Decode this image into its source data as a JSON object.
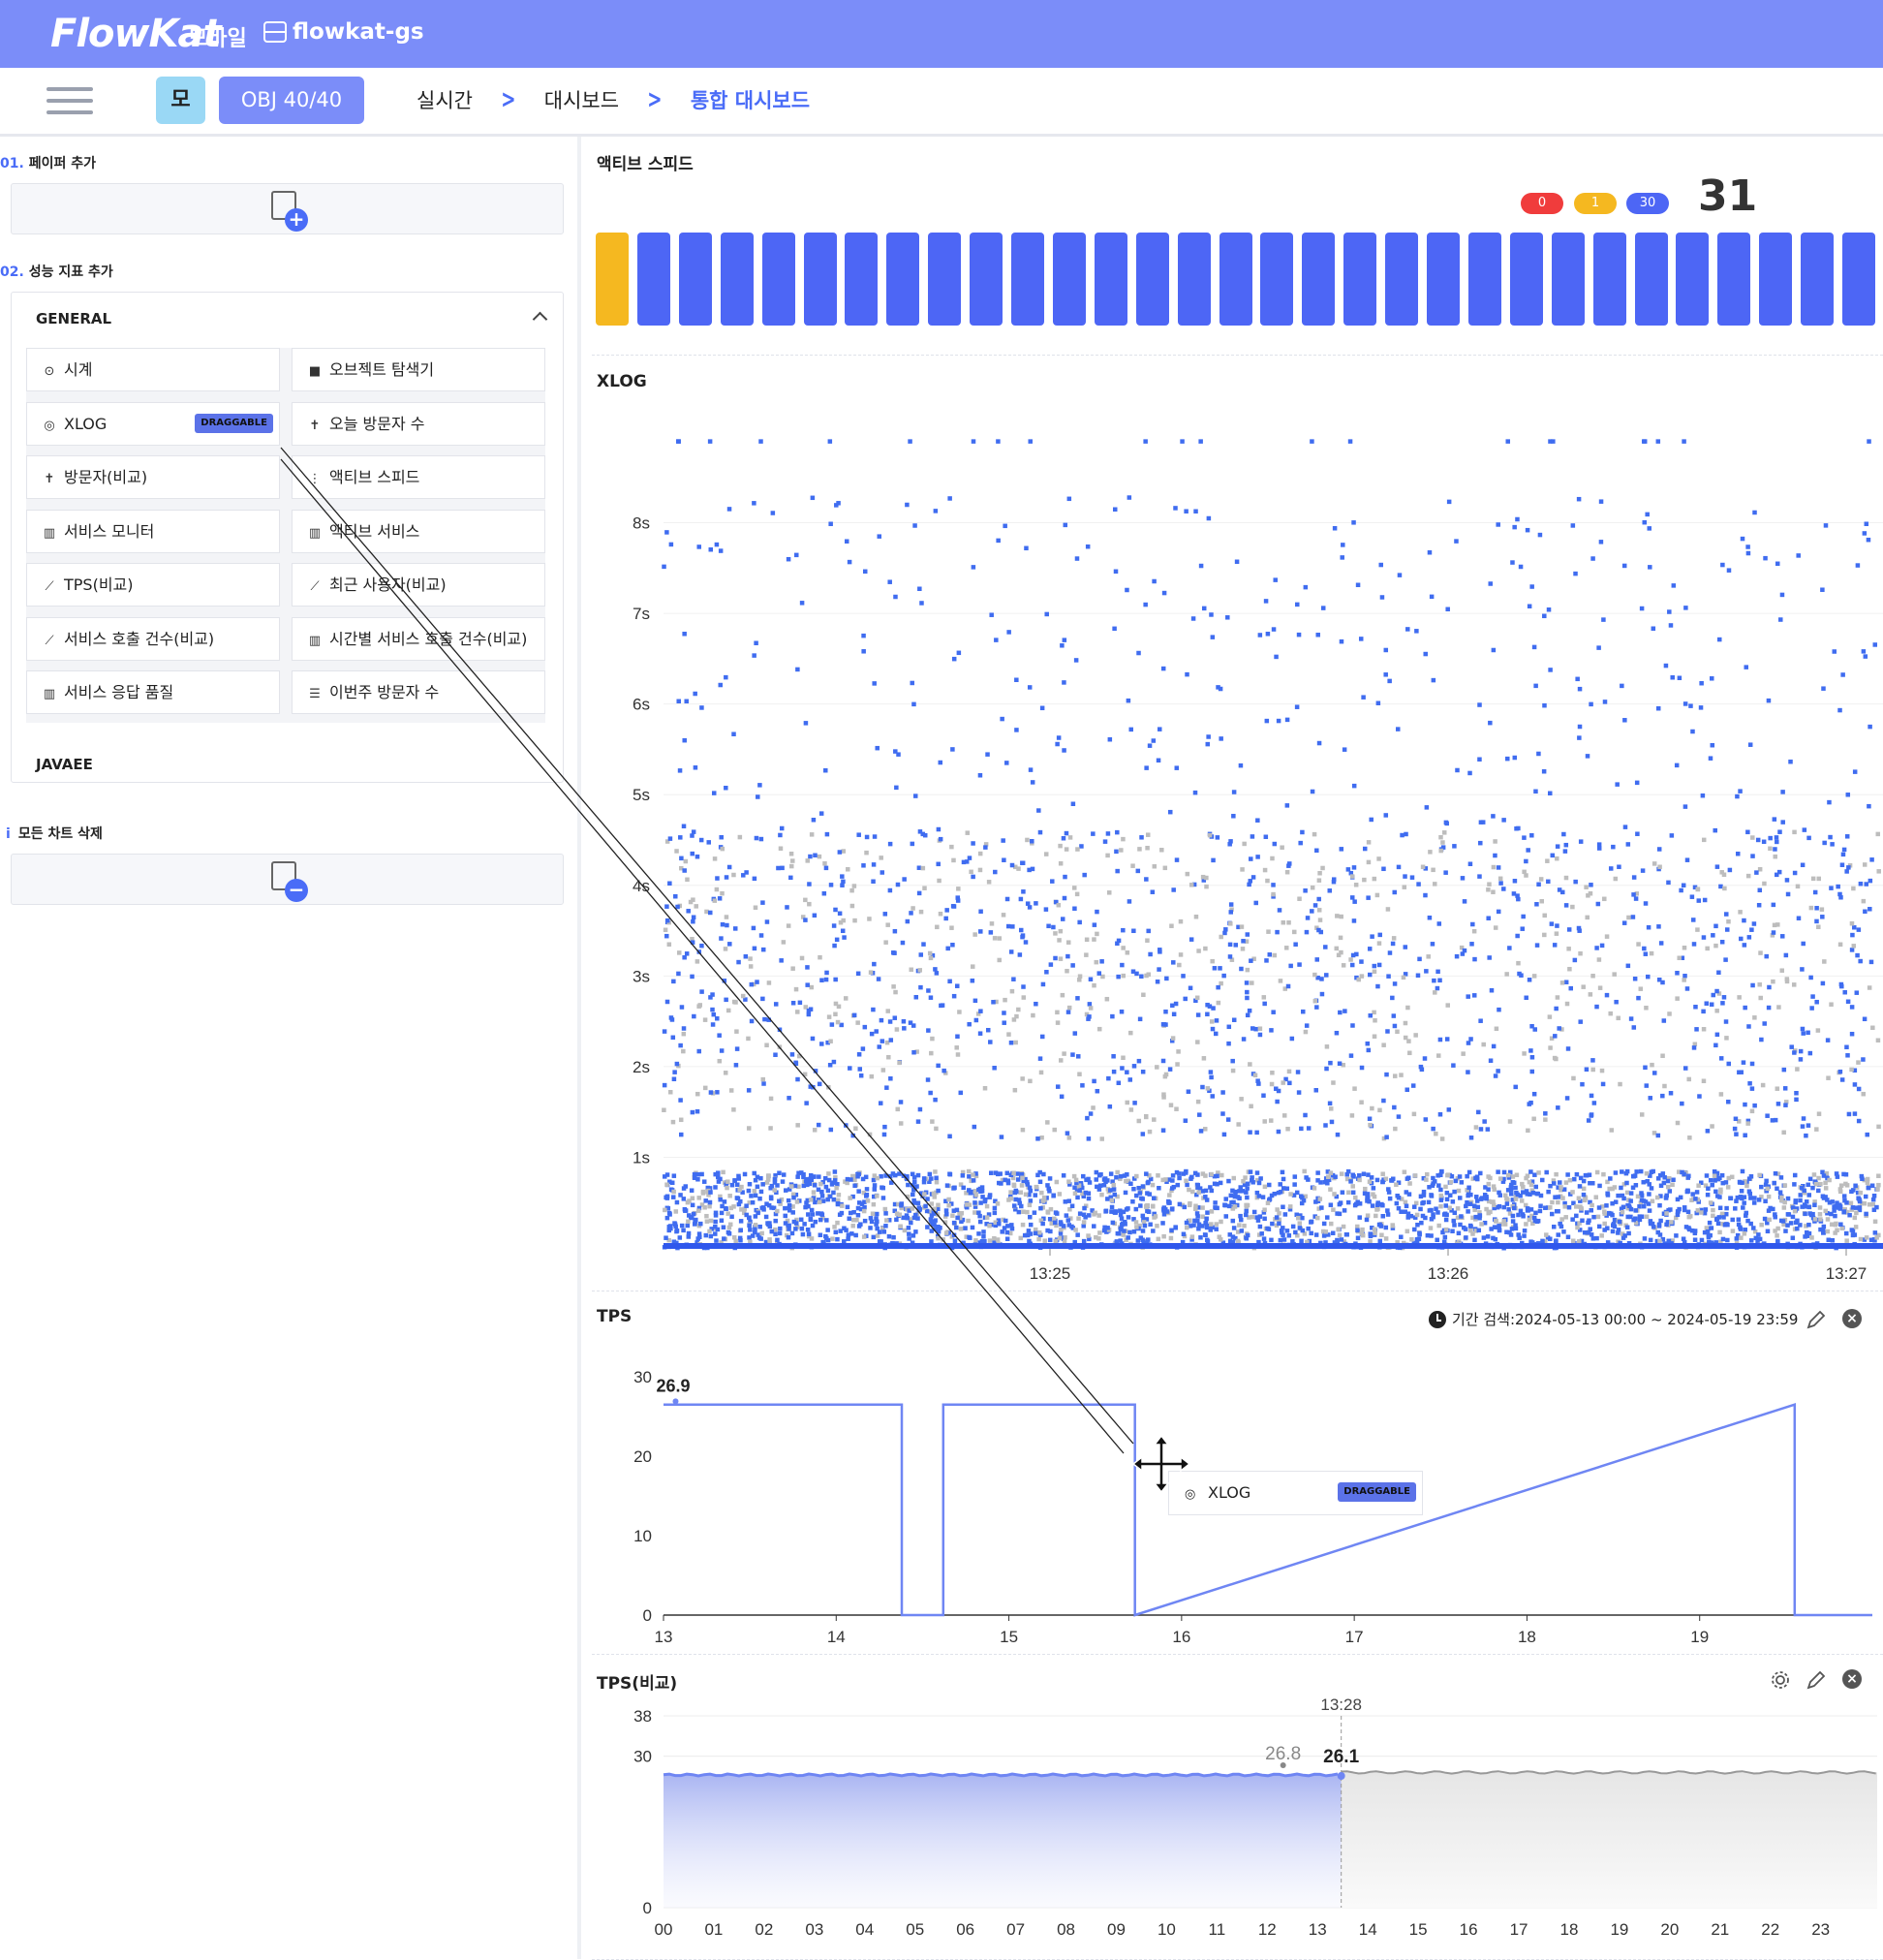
{
  "brand": {
    "logo": "FlowKat",
    "mode": "모바일",
    "server": "flowkat-gs"
  },
  "nav": {
    "mo_badge": "모",
    "obj_button": "OBJ 40/40",
    "breadcrumbs": [
      "실시간",
      "대시보드",
      "통합 대시보드"
    ]
  },
  "sidebar": {
    "sec1_num": "01.",
    "sec1_label": "페이퍼 추가",
    "sec2_num": "02.",
    "sec2_label": "성능 지표 추가",
    "group_general": "GENERAL",
    "items": [
      {
        "label": "시계",
        "icon": "clock-icon"
      },
      {
        "label": "오브젝트 탐색기",
        "icon": "folder-icon"
      },
      {
        "label": "XLOG",
        "icon": "target-icon",
        "badge": "DRAGGABLE"
      },
      {
        "label": "오늘 방문자 수",
        "icon": "person-icon"
      },
      {
        "label": "방문자(비교)",
        "icon": "person-icon"
      },
      {
        "label": "액티브 스피드",
        "icon": "vertical-dots-icon"
      },
      {
        "label": "서비스 모니터",
        "icon": "bar-chart-icon"
      },
      {
        "label": "액티브 서비스",
        "icon": "bar-chart-icon"
      },
      {
        "label": "TPS(비교)",
        "icon": "line-chart-icon"
      },
      {
        "label": "최근 사용자(비교)",
        "icon": "line-chart-icon"
      },
      {
        "label": "서비스 호출 건수(비교)",
        "icon": "line-chart-icon"
      },
      {
        "label": "시간별 서비스 호출 건수(비교)",
        "icon": "bar-chart-icon"
      },
      {
        "label": "서비스 응답 품질",
        "icon": "bar-chart-icon"
      },
      {
        "label": "이번주 방문자 수",
        "icon": "list-icon"
      }
    ],
    "group_javaee": "JAVAEE",
    "delete_label": "모든 차트 삭제"
  },
  "active_speed": {
    "title": "액티브 스피드",
    "counts": [
      {
        "value": "0",
        "color": "#F03C3C"
      },
      {
        "value": "1",
        "color": "#F5B820"
      },
      {
        "value": "30",
        "color": "#4D66F5"
      }
    ],
    "total": "31",
    "bar_count": 31,
    "bar_colors": {
      "normal": "#4D66F5",
      "warning": "#F5B820"
    }
  },
  "xlog": {
    "title": "XLOG",
    "chart_data": {
      "type": "scatter",
      "y_ticks": [
        "1s",
        "2s",
        "3s",
        "4s",
        "5s",
        "6s",
        "7s",
        "8s"
      ],
      "ylim": [
        0,
        9
      ],
      "x_ticks": [
        "13:25",
        "13:26",
        "13:27"
      ],
      "series_colors": {
        "normal": "#3F6CF0",
        "other": "#BDBDBD"
      }
    }
  },
  "tps": {
    "title": "TPS",
    "period": "기간 검색:2024-05-13 00:00 ~ 2024-05-19 23:59",
    "chart_data": {
      "type": "line",
      "x_ticks": [
        "13",
        "14",
        "15",
        "16",
        "17",
        "18",
        "19"
      ],
      "y_ticks": [
        "0",
        "10",
        "20",
        "30"
      ],
      "ylim": [
        0,
        30
      ],
      "xlim": [
        13,
        20
      ],
      "max_label": "26.9",
      "series": [
        {
          "x": [
            13,
            14.38,
            14.38,
            14.62,
            14.62,
            15.73,
            15.73,
            19.55,
            19.55,
            20
          ],
          "values": [
            26.5,
            26.5,
            0,
            0,
            26.5,
            26.5,
            0,
            26.5,
            0,
            0
          ]
        }
      ]
    }
  },
  "tps_compare": {
    "title": "TPS(비교)",
    "chart_data": {
      "type": "area",
      "x_ticks": [
        "00",
        "01",
        "02",
        "03",
        "04",
        "05",
        "06",
        "07",
        "08",
        "09",
        "10",
        "11",
        "12",
        "13",
        "14",
        "15",
        "16",
        "17",
        "18",
        "19",
        "20",
        "21",
        "22",
        "23"
      ],
      "y_ticks": [
        "0",
        "30",
        "38"
      ],
      "ylim": [
        0,
        38
      ],
      "cursor_time": "13:28",
      "cursor_value": "26.1",
      "prev_value": "26.8",
      "series": [
        {
          "x": [
            0,
            13.47
          ],
          "values": [
            26.3,
            26.1
          ]
        },
        {
          "x": [
            0,
            24
          ],
          "values": [
            26.8,
            26.8
          ]
        }
      ]
    }
  },
  "drag_ghost": {
    "label": "XLOG",
    "badge": "DRAGGABLE"
  }
}
